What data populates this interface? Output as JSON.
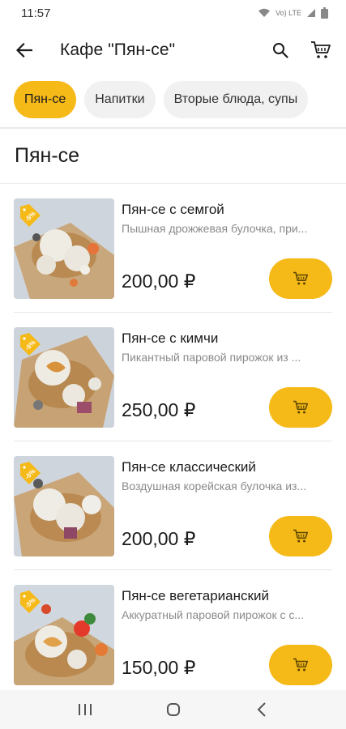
{
  "status": {
    "time": "11:57",
    "net_label": "Vo) LTE"
  },
  "header": {
    "title": "Кафе \"Пян-се\""
  },
  "chips": [
    "Пян-се",
    "Напитки",
    "Вторые блюда, супы"
  ],
  "section": {
    "title": "Пян-се"
  },
  "badge_text": "-5%",
  "products": [
    {
      "name": "Пян-се с семгой",
      "description": "Пышная дрожжевая булочка, при...",
      "price": "200,00 ₽"
    },
    {
      "name": "Пян-се с кимчи",
      "description": "Пикантный паровой пирожок из ...",
      "price": "250,00 ₽"
    },
    {
      "name": "Пян-се классический",
      "description": "Воздушная корейская булочка из...",
      "price": "200,00 ₽"
    },
    {
      "name": "Пян-се вегетарианский",
      "description": "Аккуратный паровой пирожок с с...",
      "price": "150,00 ₽"
    }
  ],
  "colors": {
    "accent": "#f5b918",
    "chip_bg": "#f1f1f1",
    "muted_text": "#8a8a8a"
  },
  "icons": {
    "back": "arrow-left-icon",
    "search": "search-icon",
    "cart": "cart-icon"
  }
}
